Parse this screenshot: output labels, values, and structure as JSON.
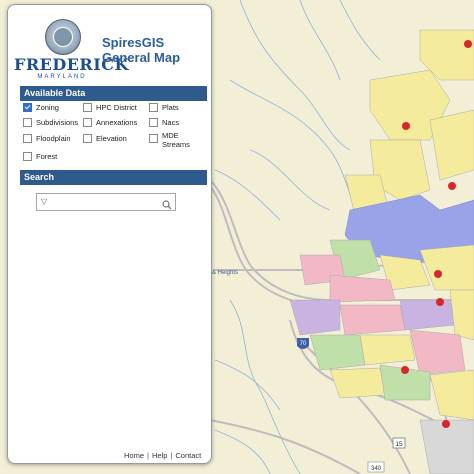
{
  "brand": {
    "name": "FREDERICK",
    "sub": "MARYLAND"
  },
  "app": {
    "title": "SpiresGIS General Map"
  },
  "available_data": {
    "header": "Available Data",
    "layers": [
      {
        "label": "Zoning",
        "checked": true
      },
      {
        "label": "HPC District",
        "checked": false
      },
      {
        "label": "Plats",
        "checked": false
      },
      {
        "label": "Subdivisions",
        "checked": false
      },
      {
        "label": "Annexations",
        "checked": false
      },
      {
        "label": "Nacs",
        "checked": false
      },
      {
        "label": "Floodplain",
        "checked": false
      },
      {
        "label": "Elevation",
        "checked": false
      },
      {
        "label": "MDE Streams",
        "checked": false
      },
      {
        "label": "Forest",
        "checked": false
      }
    ]
  },
  "search": {
    "header": "Search",
    "placeholder": "",
    "value": ""
  },
  "footer": {
    "home": "Home",
    "help": "Help",
    "contact": "Contact",
    "separator": "|"
  },
  "map": {
    "labels": {
      "heights": "& Heights",
      "interstate": "70",
      "route": "15",
      "bottom_route": "340"
    },
    "colors": {
      "background": "#f3efd6",
      "water": "#9aa3e8",
      "residential_yellow": "#f4ec9c",
      "industrial_purple": "#c9b3e0",
      "commercial_pink": "#f2b8c6",
      "green_zone": "#bfe0a8",
      "road": "#c8c8c8",
      "stream": "#8fb4d8",
      "marker_red": "#d8272b"
    }
  }
}
